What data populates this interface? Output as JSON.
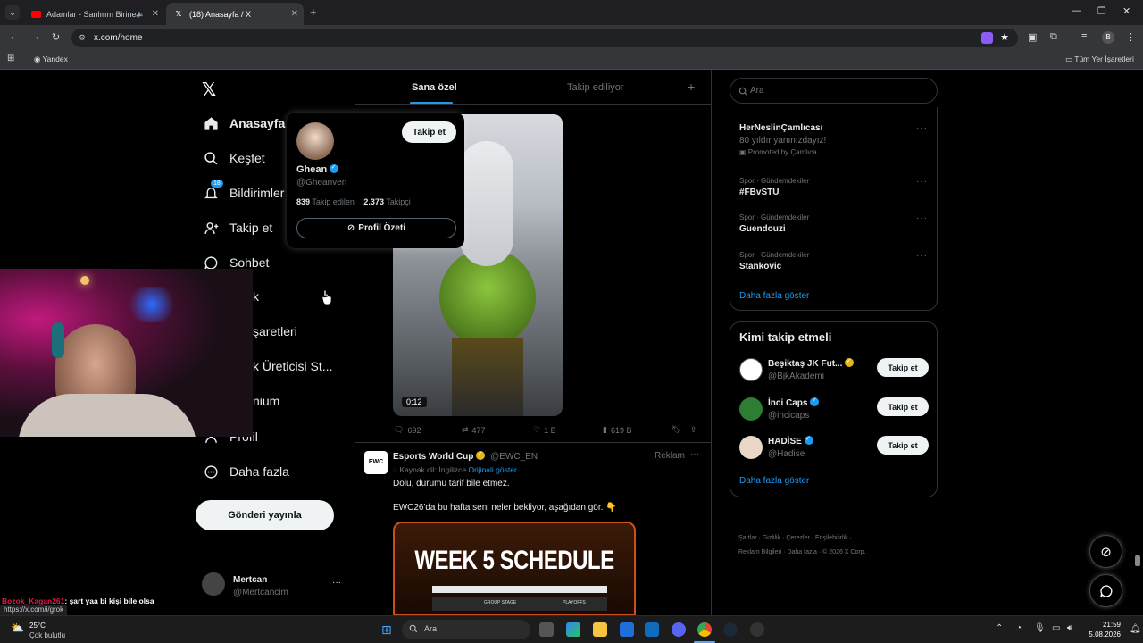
{
  "browser": {
    "tabs": [
      {
        "title": "Adamlar - Sanlırım Birine -",
        "active": false
      },
      {
        "title": "(18) Anasayfa / X",
        "active": true
      }
    ],
    "url": "x.com/home",
    "profile_initial": "B",
    "bookmarks": {
      "yandex": "Yandex",
      "all": "Tüm Yer İşaretleri"
    }
  },
  "sidebar": {
    "items": [
      {
        "label": "Anasayfa",
        "icon": "home-icon"
      },
      {
        "label": "Keşfet",
        "icon": "search-icon"
      },
      {
        "label": "Bildirimler",
        "icon": "bell-icon",
        "badge": "18"
      },
      {
        "label": "Takip et",
        "icon": "add-user-icon"
      },
      {
        "label": "Sohbet",
        "icon": "chat-icon"
      },
      {
        "label": "k",
        "icon": "grok-icon"
      },
      {
        "label": "şaretleri",
        "icon": "bookmark-icon"
      },
      {
        "label": "k Üreticisi St...",
        "icon": "creator-icon"
      },
      {
        "label": "nium",
        "icon": "premium-icon"
      },
      {
        "label": "Profil",
        "icon": "profile-icon"
      },
      {
        "label": "Daha fazla",
        "icon": "more-icon"
      }
    ],
    "post_button": "Gönderi yayınla",
    "account": {
      "name": "Mertcan",
      "handle": "@Mertcancim"
    }
  },
  "timeline": {
    "tabs": [
      "Sana özel",
      "Takip ediliyor"
    ],
    "video_duration": "0:12",
    "actions": {
      "replies": "692",
      "reposts": "477",
      "likes": "1 B",
      "views": "619 B"
    },
    "ad_post": {
      "author": "Esports World Cup",
      "handle": "@EWC_EN",
      "label": "Reklam",
      "translated_from": "Kaynak dil: İngilizce",
      "show_original": "Orijinali göster",
      "text1": "Dolu, durumu tarif bile etmez.",
      "text2": "EWC26'da bu hafta seni neler bekliyor, aşağıdan gör. 👇",
      "image_title": "WEEK 5 SCHEDULE",
      "image_col_group": "GROUP STAGE",
      "image_col_playoffs": "PLAYOFFS"
    }
  },
  "hovercard": {
    "name": "Ghean",
    "handle": "@Gheanven",
    "following_count": "839",
    "following_label": "Takip edilen",
    "followers_count": "2.373",
    "followers_label": "Takipçi",
    "follow_button": "Takip et",
    "summary_button": "Profil Özeti"
  },
  "right": {
    "search_placeholder": "Ara",
    "trends": [
      {
        "cat": "",
        "name": "HerNeslinÇamlıcası",
        "sub": "80 yıldır yanınızdayız!",
        "promo": "Promoted by Çamlıca"
      },
      {
        "cat": "Spor · Gündemdekiler",
        "name": "#FBvSTU"
      },
      {
        "cat": "Spor · Gündemdekiler",
        "name": "Guendouzi"
      },
      {
        "cat": "Spor · Gündemdekiler",
        "name": "Stankovic"
      }
    ],
    "show_more": "Daha fazla göster",
    "who_to_follow_title": "Kimi takip etmeli",
    "who_to_follow": [
      {
        "name": "Beşiktaş JK Fut...",
        "handle": "@BjkAkademi",
        "button": "Takip et"
      },
      {
        "name": "İnci Caps",
        "handle": "@incicaps",
        "button": "Takip et"
      },
      {
        "name": "HADİSE",
        "handle": "@Hadise",
        "button": "Takip et"
      }
    ],
    "show_more2": "Daha fazla göster",
    "footer": {
      "row1": [
        "Şartlar",
        "Gizlilik",
        "Çerezler",
        "Erişilebilirlik"
      ],
      "row2": [
        "Reklam Bilgileri",
        "Daha fazla",
        "© 2026 X Corp."
      ]
    }
  },
  "stream_chat": {
    "user": "Bozok_Kagan261",
    "message": ": şart yaa bi kişi bile olsa"
  },
  "status_url": "https://x.com/i/grok",
  "taskbar": {
    "weather_temp": "25°C",
    "weather_desc": "Çok bulutlu",
    "search": "Ara",
    "time": "21:59",
    "date": "5.08.2026"
  },
  "colors": {
    "accent": "#1d9bf0",
    "verified_gold": "#e2b719",
    "bg": "#000000"
  }
}
